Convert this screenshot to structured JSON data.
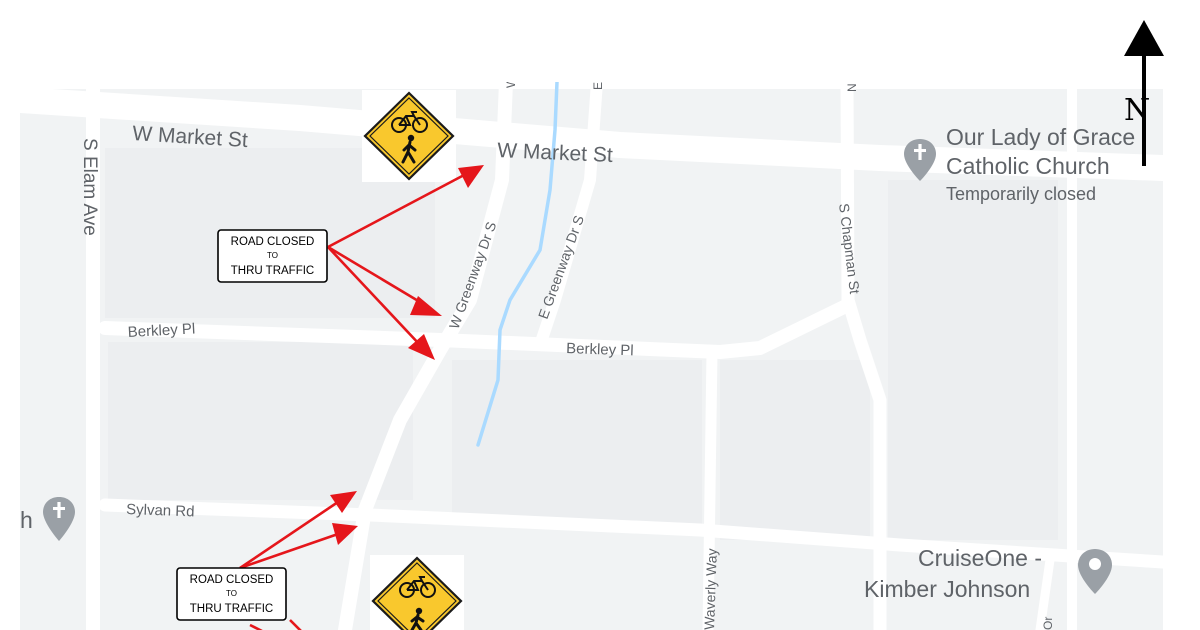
{
  "map": {
    "streets": {
      "w_market_st_west": "W Market St",
      "w_market_st_center": "W Market St",
      "s_elam_ave": "S Elam Ave",
      "w_greenway_dr_s": "W Greenway Dr S",
      "e_greenway_dr_s": "E Greenway Dr S",
      "s_chapman_st": "S Chapman St",
      "berkley_pl_west": "Berkley Pl",
      "berkley_pl_center": "Berkley Pl",
      "sylvan_rd": "Sylvan Rd",
      "waverly_way": "Waverly Way"
    },
    "pois": {
      "church_name_line1": "Our Lady of Grace",
      "church_name_line2": "Catholic Church",
      "church_status": "Temporarily closed",
      "church_left_partial": "h",
      "cruiseone_line1": "CruiseOne -",
      "cruiseone_line2": "Kimber Johnson"
    },
    "signs": {
      "road_closed_line1": "ROAD CLOSED",
      "road_closed_line2": "TO",
      "road_closed_line3": "THRU TRAFFIC"
    },
    "north_arrow": {
      "label": "N"
    },
    "icons": [
      "bike-pedestrian-crossing-sign-icon",
      "cross-pin-icon",
      "location-pin-icon",
      "north-arrow-icon"
    ],
    "colors": {
      "map_background": "#f1f3f4",
      "road": "#ffffff",
      "stream": "#aadaff",
      "annotation_arrow": "#e5161b",
      "warning_sign": "#f9c82d",
      "poi_pin": "#9aa0a6"
    }
  }
}
